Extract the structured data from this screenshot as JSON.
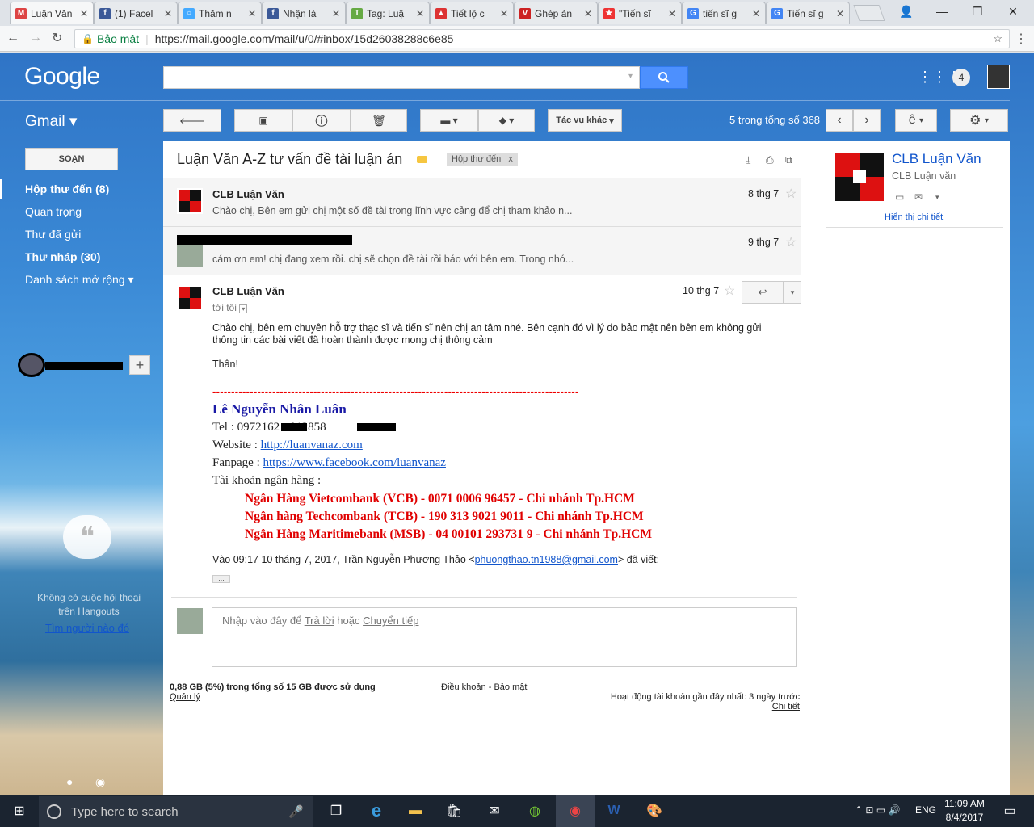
{
  "browser": {
    "tabs": [
      {
        "title": "Luận Văn",
        "icon": "gmail-icon",
        "active": true
      },
      {
        "title": "(1) Facel",
        "icon": "facebook-icon"
      },
      {
        "title": "Thăm n",
        "icon": "loading-icon"
      },
      {
        "title": "Nhận là",
        "icon": "facebook-icon"
      },
      {
        "title": "Tag: Luậ",
        "icon": "tag-icon"
      },
      {
        "title": "Tiết lộ c",
        "icon": "triangle-icon"
      },
      {
        "title": "Ghép ản",
        "icon": "v-icon"
      },
      {
        "title": "\"Tiến sĩ",
        "icon": "red-icon"
      },
      {
        "title": "tiến sĩ g",
        "icon": "google-icon"
      },
      {
        "title": "Tiến sĩ g",
        "icon": "google-icon"
      }
    ],
    "secure_label": "Bảo mật",
    "url": "https://mail.google.com/mail/u/0/#inbox/15d26038288c6e85"
  },
  "header": {
    "logo": "Google",
    "gmail_label": "Gmail ▾",
    "notification_count": "4",
    "more_actions": "Tác vụ khác",
    "pagination": "5 trong tổng số 368",
    "input_tool": "ê"
  },
  "sidebar": {
    "compose": "SOẠN",
    "items": [
      {
        "label": "Hộp thư đến (8)",
        "bold": true
      },
      {
        "label": "Quan trọng"
      },
      {
        "label": "Thư đã gửi"
      },
      {
        "label": "Thư nháp (30)",
        "bold": true
      },
      {
        "label": "Danh sách mở rộng ▾"
      }
    ],
    "hangouts_empty": "Không có cuộc hội thoại trên Hangouts",
    "hangouts_find": "Tìm người nào đó"
  },
  "thread": {
    "subject": "Luận Văn A-Z tư vấn đề tài luận án",
    "label": "Hộp thư đến",
    "label_close": "x",
    "messages": [
      {
        "sender": "CLB Luận Văn",
        "date": "8 thg 7",
        "snippet": "Chào chị, Bên em gửi chị một số đề tài trong lĩnh vực cảng để chị tham khảo n..."
      },
      {
        "sender": "",
        "date": "9 thg 7",
        "snippet": "cám ơn em! chị đang xem rồi. chị sẽ chọn đề tài rồi báo với bên em. Trong nhó..."
      }
    ],
    "expanded": {
      "sender": "CLB Luận Văn",
      "date": "10 thg 7",
      "to": "tới tôi",
      "body1": "Chào chị, bên em chuyên hỗ trợ thạc sĩ và tiến sĩ nên chị an tâm nhé. Bên cạnh đó vì lý do bảo mật nên bên em không gửi thông tin các bài viết đã hoàn thành được mong chị thông cảm",
      "body2": "Thân!",
      "dashes": "--------------------------------------------------------------------------------------------------",
      "sig_name": "Lê Nguyễn Nhân Luân",
      "sig_tel": "Tel : 0972162 - 012858",
      "sig_web_label": "Website : ",
      "sig_web": "http://luanvanaz.com",
      "sig_fan_label": "Fanpage : ",
      "sig_fan": "https://www.facebook.com/luanvanaz",
      "sig_bank": "Tài khoản ngân hàng :",
      "banks": [
        "Ngân Hàng Vietcombank (VCB) - 0071 0006 96457 - Chi nhánh Tp.HCM",
        "Ngân hàng Techcombank (TCB) - 190 313 9021 9011 - Chi nhánh Tp.HCM",
        "Ngân Hàng Maritimebank (MSB) - 04 00101 293731 9 - Chi nhánh Tp.HCM"
      ],
      "quote_prefix": "Vào 09:17 10 tháng 7, 2017, Trần Nguyễn Phương Thảo <",
      "quote_email": "phuongthao.tn1988@gmail.com",
      "quote_suffix": "> đã viết:",
      "ellipsis": "..."
    },
    "reply_prompt": "Nhập vào đây để",
    "reply_link": "Trả lời",
    "reply_or": "hoặc",
    "forward_link": "Chuyển tiếp"
  },
  "footer": {
    "storage": "0,88 GB (5%) trong tổng số 15 GB được sử dụng",
    "manage": "Quản lý",
    "terms": "Điều khoản",
    "privacy": "Bảo mật",
    "sep": "-",
    "activity": "Hoạt động tài khoản gần đây nhất: 3 ngày trước",
    "details": "Chi tiết"
  },
  "contact": {
    "name": "CLB Luận Văn",
    "sub": "CLB Luận văn",
    "show": "Hiển thị chi tiết"
  },
  "taskbar": {
    "search": "Type here to search",
    "lang": "ENG",
    "time": "11:09 AM",
    "date": "8/4/2017"
  },
  "colors": {
    "link": "#1155cc",
    "signature_name": "#1a1aa6",
    "bank_red": "#e00000",
    "search_blue": "#4d90fe"
  }
}
